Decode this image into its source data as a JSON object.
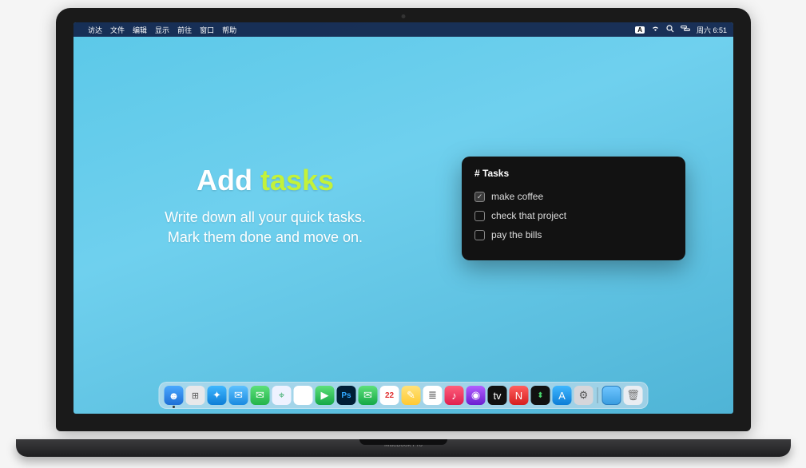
{
  "menubar": {
    "app": "访达",
    "items": [
      "文件",
      "编辑",
      "显示",
      "前往",
      "窗口",
      "帮助"
    ],
    "input_indicator": "A",
    "clock": "周六 6:51"
  },
  "marketing": {
    "title_left": "Add ",
    "title_accent": "tasks",
    "subtitle_line1": "Write down all your quick tasks.",
    "subtitle_line2": "Mark them done and move on."
  },
  "tasks": {
    "header": "# Tasks",
    "items": [
      {
        "label": "make coffee",
        "checked": true
      },
      {
        "label": "check that project",
        "checked": false
      },
      {
        "label": "pay the bills",
        "checked": false
      }
    ]
  },
  "dock": {
    "items": [
      {
        "name": "finder",
        "glyph": "☻",
        "cls": "di-finder",
        "running": true
      },
      {
        "name": "launchpad",
        "glyph": "⊞",
        "cls": "di-launchpad",
        "running": false
      },
      {
        "name": "safari",
        "glyph": "✦",
        "cls": "di-safari",
        "running": false
      },
      {
        "name": "mail",
        "glyph": "✉",
        "cls": "di-mail",
        "running": false
      },
      {
        "name": "messages",
        "glyph": "✉",
        "cls": "di-messages",
        "running": false
      },
      {
        "name": "maps",
        "glyph": "⌖",
        "cls": "di-maps",
        "running": false
      },
      {
        "name": "photos",
        "glyph": "❀",
        "cls": "di-photos",
        "running": false
      },
      {
        "name": "facetime",
        "glyph": "▶",
        "cls": "di-facetime",
        "running": false
      },
      {
        "name": "photoshop",
        "glyph": "Ps",
        "cls": "di-ps",
        "running": false
      },
      {
        "name": "wechat",
        "glyph": "✉",
        "cls": "di-wechat",
        "running": false
      },
      {
        "name": "calendar",
        "glyph": "22",
        "cls": "di-calendar",
        "running": false
      },
      {
        "name": "notes",
        "glyph": "✎",
        "cls": "di-notes",
        "running": false
      },
      {
        "name": "reminders",
        "glyph": "≣",
        "cls": "di-reminders",
        "running": false
      },
      {
        "name": "music",
        "glyph": "♪",
        "cls": "di-music",
        "running": false
      },
      {
        "name": "podcasts",
        "glyph": "◉",
        "cls": "di-podcasts",
        "running": false
      },
      {
        "name": "tv",
        "glyph": "tv",
        "cls": "di-tv",
        "running": false
      },
      {
        "name": "news",
        "glyph": "N",
        "cls": "di-news",
        "running": false
      },
      {
        "name": "stocks",
        "glyph": "⬍",
        "cls": "di-stocks",
        "running": false
      },
      {
        "name": "appstore",
        "glyph": "A",
        "cls": "di-appstore",
        "running": false
      },
      {
        "name": "settings",
        "glyph": "⚙",
        "cls": "di-settings",
        "running": false
      }
    ],
    "right_items": [
      {
        "name": "downloads-folder",
        "glyph": "",
        "cls": "di-folder",
        "running": false
      },
      {
        "name": "trash",
        "glyph": "🗑",
        "cls": "di-trash",
        "running": false
      }
    ]
  },
  "laptop": {
    "model": "MacBook Pro"
  }
}
